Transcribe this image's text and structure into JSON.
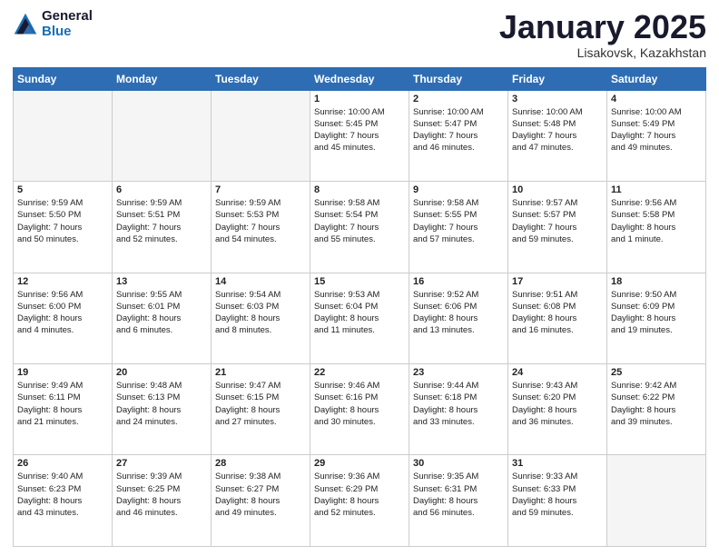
{
  "header": {
    "logo_general": "General",
    "logo_blue": "Blue",
    "month_title": "January 2025",
    "subtitle": "Lisakovsk, Kazakhstan"
  },
  "weekdays": [
    "Sunday",
    "Monday",
    "Tuesday",
    "Wednesday",
    "Thursday",
    "Friday",
    "Saturday"
  ],
  "weeks": [
    [
      {
        "day": "",
        "info": ""
      },
      {
        "day": "",
        "info": ""
      },
      {
        "day": "",
        "info": ""
      },
      {
        "day": "1",
        "info": "Sunrise: 10:00 AM\nSunset: 5:45 PM\nDaylight: 7 hours\nand 45 minutes."
      },
      {
        "day": "2",
        "info": "Sunrise: 10:00 AM\nSunset: 5:47 PM\nDaylight: 7 hours\nand 46 minutes."
      },
      {
        "day": "3",
        "info": "Sunrise: 10:00 AM\nSunset: 5:48 PM\nDaylight: 7 hours\nand 47 minutes."
      },
      {
        "day": "4",
        "info": "Sunrise: 10:00 AM\nSunset: 5:49 PM\nDaylight: 7 hours\nand 49 minutes."
      }
    ],
    [
      {
        "day": "5",
        "info": "Sunrise: 9:59 AM\nSunset: 5:50 PM\nDaylight: 7 hours\nand 50 minutes."
      },
      {
        "day": "6",
        "info": "Sunrise: 9:59 AM\nSunset: 5:51 PM\nDaylight: 7 hours\nand 52 minutes."
      },
      {
        "day": "7",
        "info": "Sunrise: 9:59 AM\nSunset: 5:53 PM\nDaylight: 7 hours\nand 54 minutes."
      },
      {
        "day": "8",
        "info": "Sunrise: 9:58 AM\nSunset: 5:54 PM\nDaylight: 7 hours\nand 55 minutes."
      },
      {
        "day": "9",
        "info": "Sunrise: 9:58 AM\nSunset: 5:55 PM\nDaylight: 7 hours\nand 57 minutes."
      },
      {
        "day": "10",
        "info": "Sunrise: 9:57 AM\nSunset: 5:57 PM\nDaylight: 7 hours\nand 59 minutes."
      },
      {
        "day": "11",
        "info": "Sunrise: 9:56 AM\nSunset: 5:58 PM\nDaylight: 8 hours\nand 1 minute."
      }
    ],
    [
      {
        "day": "12",
        "info": "Sunrise: 9:56 AM\nSunset: 6:00 PM\nDaylight: 8 hours\nand 4 minutes."
      },
      {
        "day": "13",
        "info": "Sunrise: 9:55 AM\nSunset: 6:01 PM\nDaylight: 8 hours\nand 6 minutes."
      },
      {
        "day": "14",
        "info": "Sunrise: 9:54 AM\nSunset: 6:03 PM\nDaylight: 8 hours\nand 8 minutes."
      },
      {
        "day": "15",
        "info": "Sunrise: 9:53 AM\nSunset: 6:04 PM\nDaylight: 8 hours\nand 11 minutes."
      },
      {
        "day": "16",
        "info": "Sunrise: 9:52 AM\nSunset: 6:06 PM\nDaylight: 8 hours\nand 13 minutes."
      },
      {
        "day": "17",
        "info": "Sunrise: 9:51 AM\nSunset: 6:08 PM\nDaylight: 8 hours\nand 16 minutes."
      },
      {
        "day": "18",
        "info": "Sunrise: 9:50 AM\nSunset: 6:09 PM\nDaylight: 8 hours\nand 19 minutes."
      }
    ],
    [
      {
        "day": "19",
        "info": "Sunrise: 9:49 AM\nSunset: 6:11 PM\nDaylight: 8 hours\nand 21 minutes."
      },
      {
        "day": "20",
        "info": "Sunrise: 9:48 AM\nSunset: 6:13 PM\nDaylight: 8 hours\nand 24 minutes."
      },
      {
        "day": "21",
        "info": "Sunrise: 9:47 AM\nSunset: 6:15 PM\nDaylight: 8 hours\nand 27 minutes."
      },
      {
        "day": "22",
        "info": "Sunrise: 9:46 AM\nSunset: 6:16 PM\nDaylight: 8 hours\nand 30 minutes."
      },
      {
        "day": "23",
        "info": "Sunrise: 9:44 AM\nSunset: 6:18 PM\nDaylight: 8 hours\nand 33 minutes."
      },
      {
        "day": "24",
        "info": "Sunrise: 9:43 AM\nSunset: 6:20 PM\nDaylight: 8 hours\nand 36 minutes."
      },
      {
        "day": "25",
        "info": "Sunrise: 9:42 AM\nSunset: 6:22 PM\nDaylight: 8 hours\nand 39 minutes."
      }
    ],
    [
      {
        "day": "26",
        "info": "Sunrise: 9:40 AM\nSunset: 6:23 PM\nDaylight: 8 hours\nand 43 minutes."
      },
      {
        "day": "27",
        "info": "Sunrise: 9:39 AM\nSunset: 6:25 PM\nDaylight: 8 hours\nand 46 minutes."
      },
      {
        "day": "28",
        "info": "Sunrise: 9:38 AM\nSunset: 6:27 PM\nDaylight: 8 hours\nand 49 minutes."
      },
      {
        "day": "29",
        "info": "Sunrise: 9:36 AM\nSunset: 6:29 PM\nDaylight: 8 hours\nand 52 minutes."
      },
      {
        "day": "30",
        "info": "Sunrise: 9:35 AM\nSunset: 6:31 PM\nDaylight: 8 hours\nand 56 minutes."
      },
      {
        "day": "31",
        "info": "Sunrise: 9:33 AM\nSunset: 6:33 PM\nDaylight: 8 hours\nand 59 minutes."
      },
      {
        "day": "",
        "info": ""
      }
    ]
  ]
}
